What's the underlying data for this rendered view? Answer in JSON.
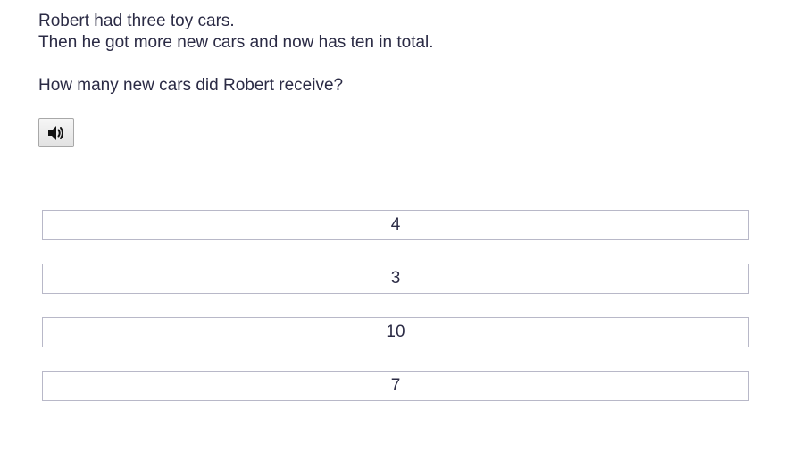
{
  "question": {
    "line1": "Robert had three toy cars.",
    "line2": "Then he got more new cars and now has ten in total.",
    "prompt": "How many new cars did Robert receive?"
  },
  "audio_button": {
    "icon": "speaker-icon"
  },
  "answers": [
    "4",
    "3",
    "10",
    "7"
  ]
}
